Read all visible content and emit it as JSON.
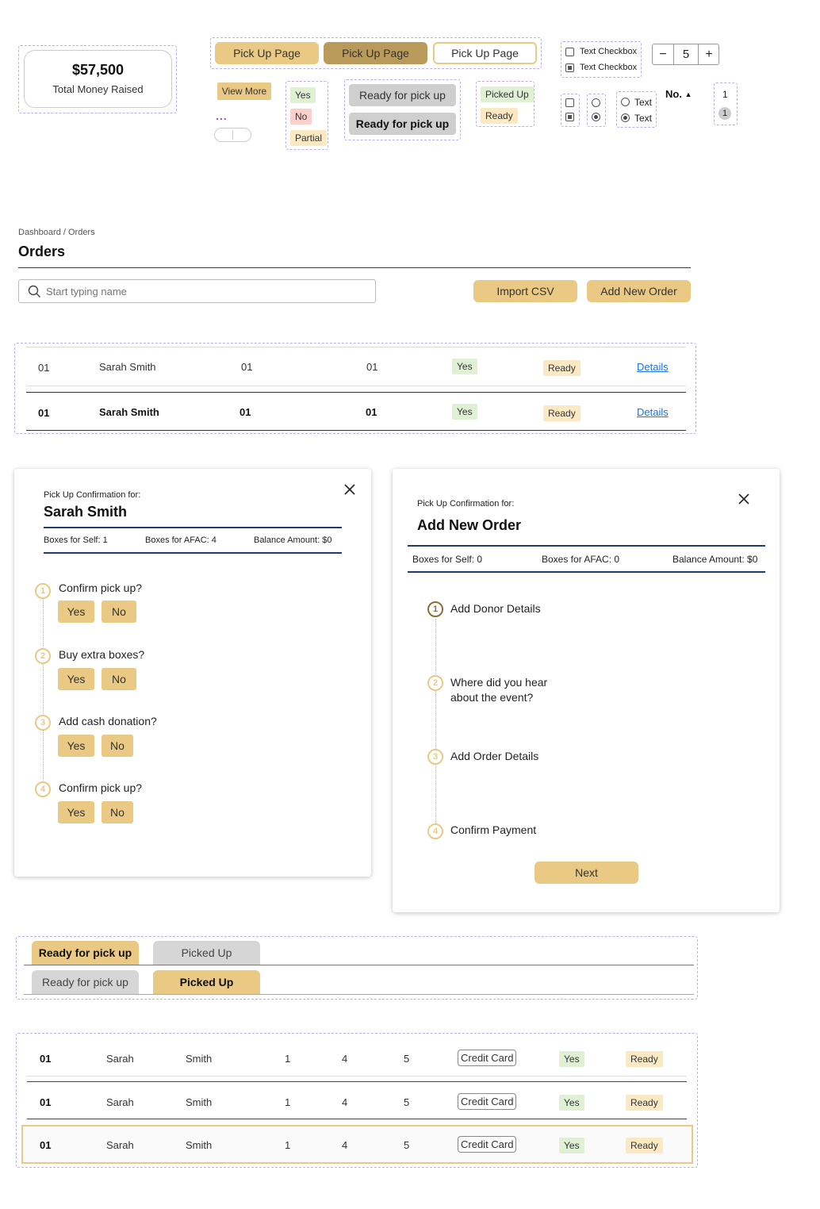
{
  "stat": {
    "amount": "$57,500",
    "label": "Total Money Raised"
  },
  "buttons": {
    "pickup1": "Pick Up Page",
    "pickup2": "Pick Up Page",
    "pickup3": "Pick Up Page",
    "view_more": "View More",
    "dots": "..."
  },
  "tags": {
    "yes": "Yes",
    "no": "No",
    "partial": "Partial",
    "picked_up": "Picked Up",
    "ready": "Ready"
  },
  "status_buttons": {
    "ready1": "Ready for pick up",
    "ready2": "Ready for pick up"
  },
  "checkboxes": {
    "label1": "Text Checkbox",
    "label2": "Text Checkbox"
  },
  "radios": {
    "label1": "Text",
    "label2": "Text"
  },
  "stepper": {
    "value": "5",
    "minus": "−",
    "plus": "+"
  },
  "sort": {
    "label": "No.",
    "icon": "sort-icon"
  },
  "pager": {
    "p1": "1",
    "p2": "1"
  },
  "orders": {
    "breadcrumb": "Dashboard / Orders",
    "title": "Orders",
    "search_placeholder": "Start typing name",
    "import": "Import CSV",
    "add": "Add New Order",
    "rows": [
      {
        "id": "01",
        "name": "Sarah Smith",
        "a": "01",
        "b": "01",
        "paid": "Yes",
        "status": "Ready",
        "link": "Details"
      },
      {
        "id": "01",
        "name": "Sarah Smith",
        "a": "01",
        "b": "01",
        "paid": "Yes",
        "status": "Ready",
        "link": "Details"
      }
    ]
  },
  "modal1": {
    "pre": "Pick Up Confirmation for:",
    "name": "Sarah Smith",
    "self": "Boxes for Self: 1",
    "afac": "Boxes for AFAC: 4",
    "balance": "Balance Amount: $0",
    "steps": [
      {
        "n": "1",
        "q": "Confirm pick up?",
        "yes": "Yes",
        "no": "No"
      },
      {
        "n": "2",
        "q": "Buy extra boxes?",
        "yes": "Yes",
        "no": "No"
      },
      {
        "n": "3",
        "q": "Add cash donation?",
        "yes": "Yes",
        "no": "No"
      },
      {
        "n": "4",
        "q": "Confirm pick up?",
        "yes": "Yes",
        "no": "No"
      }
    ]
  },
  "modal2": {
    "pre": "Pick Up Confirmation for:",
    "name": "Add New Order",
    "self": "Boxes for Self: 0",
    "afac": "Boxes for AFAC: 0",
    "balance": "Balance Amount: $0",
    "steps": [
      {
        "n": "1",
        "label": "Add Donor Details"
      },
      {
        "n": "2",
        "label": "Where did you hear",
        "label2": "about the event?"
      },
      {
        "n": "3",
        "label": "Add Order Details"
      },
      {
        "n": "4",
        "label": "Confirm Payment"
      }
    ],
    "next": "Next"
  },
  "tabs": {
    "ready": "Ready for pick up",
    "picked": "Picked Up"
  },
  "table2": {
    "rows": [
      {
        "id": "01",
        "first": "Sarah",
        "last": "Smith",
        "c1": "1",
        "c2": "4",
        "c3": "5",
        "method": "Credit Card",
        "paid": "Yes",
        "status": "Ready"
      },
      {
        "id": "01",
        "first": "Sarah",
        "last": "Smith",
        "c1": "1",
        "c2": "4",
        "c3": "5",
        "method": "Credit Card",
        "paid": "Yes",
        "status": "Ready"
      },
      {
        "id": "01",
        "first": "Sarah",
        "last": "Smith",
        "c1": "1",
        "c2": "4",
        "c3": "5",
        "method": "Credit Card",
        "paid": "Yes",
        "status": "Ready"
      }
    ]
  },
  "colors": {
    "gold": "#e9c984",
    "gold_dark": "#b99a5b",
    "navy": "#1f3b6e",
    "selection": "#b9aef0"
  }
}
